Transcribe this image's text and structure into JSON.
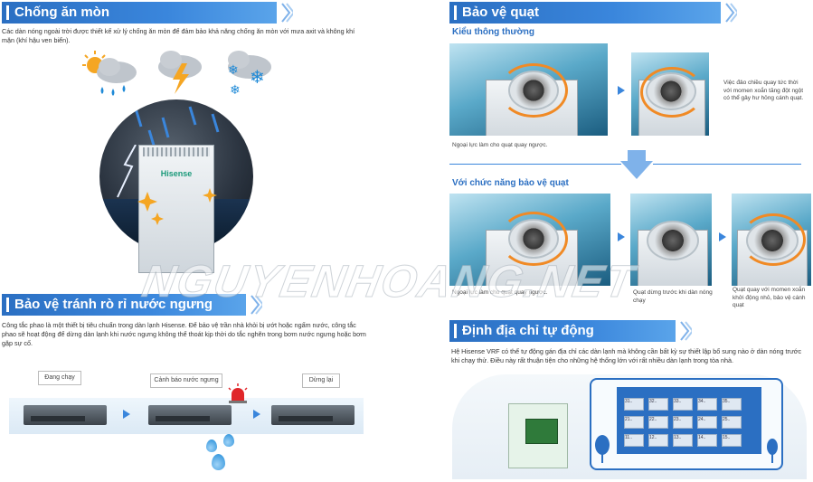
{
  "corrosion": {
    "title": "Chống ăn mòn",
    "text": "Các dàn nóng ngoài trời được thiết kế xử lý chống ăn mòn để đảm bảo khả năng chống ăn mòn với mưa axit và không khí mặn (khí hậu ven biển).",
    "brand": "Hisense",
    "icons": [
      "sun-rain-icon",
      "storm-lightning-icon",
      "snow-icon"
    ]
  },
  "fan_protect": {
    "title": "Bảo vệ quạt",
    "normal_title": "Kiểu thông thường",
    "normal_caption_left": "Ngoại lực làm cho quạt quay ngược.",
    "normal_caption_right": "Việc đảo chiều quay tức thời với momen xoắn tăng đột ngột có thể gây hư hỏng cánh quạt.",
    "with_title": "Với chức năng bảo vệ quạt",
    "with_caption_1": "Ngoại lực làm cho quạt quay ngược.",
    "with_caption_2": "Quạt dừng trước khi dàn nóng chạy",
    "with_caption_3": "Quạt quay với momen xoắn khởi động nhỏ, bảo vệ cánh quạt"
  },
  "leak": {
    "title": "Bảo vệ tránh rò rỉ nước ngưng",
    "text": "Công tắc phao là một thiết bị tiêu chuẩn trong dàn lạnh Hisense. Để bảo vệ trần nhà khỏi bị ướt hoặc ngấm nước, công tắc phao sẽ hoạt động để dừng dàn lạnh khi nước ngưng không thể thoát kịp thời do tắc nghẽn trong bơm nước ngưng hoặc bơm gặp sự cố.",
    "label_running": "Đang chạy",
    "label_alarm": "Cảnh báo nước ngưng",
    "label_stop": "Dừng lại"
  },
  "address": {
    "title": "Định địa chỉ tự động",
    "text": "Hệ Hisense VRF có thể tự động gán địa chỉ các dàn lạnh mà không cần bất kỳ sự thiết lập bổ sung nào ở dàn nóng trước khi chạy thử. Điều này rất thuận tiện cho những hệ thống lớn với rất nhiều dàn lạnh trong tòa nhà.",
    "rooms": [
      "31..",
      "32..",
      "33..",
      "34..",
      "35..",
      "21..",
      "22..",
      "23..",
      "24..",
      "25..",
      "11..",
      "12..",
      "13..",
      "14..",
      "15.."
    ]
  },
  "watermark": "NGUYENHOANG.NET",
  "colors": {
    "accent": "#2b6fc2",
    "swirl": "#f08a25",
    "drop": "#1f8ad7"
  }
}
